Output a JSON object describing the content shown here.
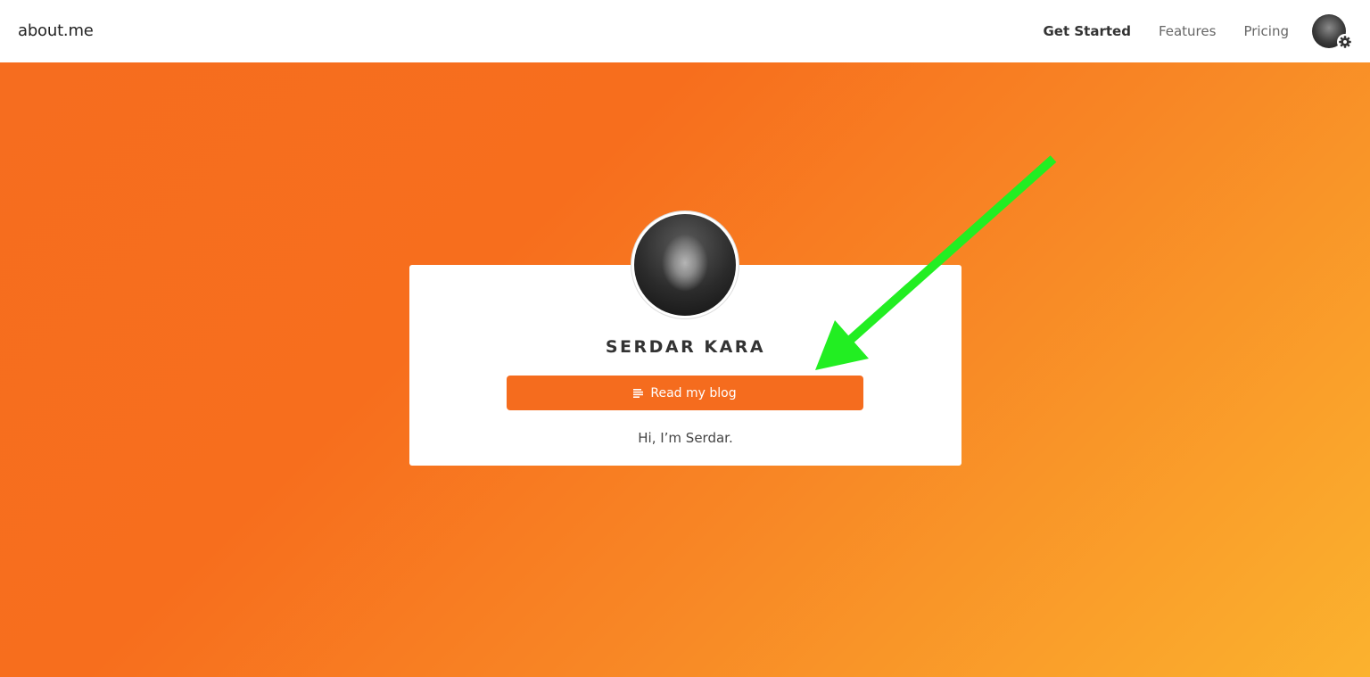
{
  "nav": {
    "logo": "about.me",
    "links": [
      "Get Started",
      "Features",
      "Pricing"
    ]
  },
  "profile": {
    "name": "SERDAR KARA",
    "button_label": "Read my blog",
    "button_icon": "blog-lines-icon",
    "bio": "Hi, I’m Serdar."
  },
  "colors": {
    "accent": "#f56c1e",
    "gradient_start": "#f66d1f",
    "gradient_end": "#fbb22e",
    "annotation_arrow": "#22ee22"
  }
}
